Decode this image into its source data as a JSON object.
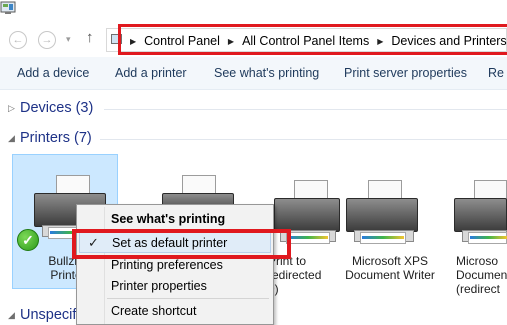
{
  "window": {
    "icon": "control-panel-icon"
  },
  "address": {
    "back_icon": "back-arrow-icon",
    "forward_icon": "forward-arrow-icon",
    "up_icon": "up-arrow-icon",
    "location_icon": "control-panel-icon",
    "back_glyph": "←",
    "forward_glyph": "→",
    "dropdown_glyph": "▾",
    "up_glyph": "↑",
    "separator_glyph": "▶",
    "breadcrumbs": [
      "Control Panel",
      "All Control Panel Items",
      "Devices and Printers"
    ]
  },
  "commandbar": {
    "items": [
      "Add a device",
      "Add a printer",
      "See what's printing",
      "Print server properties",
      "Re"
    ]
  },
  "groups": {
    "devices": {
      "label": "Devices (3)",
      "chevron": "▷"
    },
    "printers": {
      "label": "Printers (7)",
      "chevron": "◢"
    },
    "unspecified": {
      "label": "Unspecif",
      "chevron": "◢"
    }
  },
  "printers": [
    {
      "line1": "Bullzip",
      "line2": "Printe",
      "default": true
    },
    {
      "line1": "",
      "line2": ""
    },
    {
      "line1": "Print to",
      "line2": "redirected",
      "line3": "9)"
    },
    {
      "line1": "Microsoft XPS",
      "line2": "Document Writer"
    },
    {
      "line1": "Microso",
      "line2": "Documen",
      "line3": "(redirect"
    }
  ],
  "default_badge": "✓",
  "context_menu": {
    "check_glyph": "✓",
    "items": [
      {
        "label": "See what's printing",
        "bold": true
      },
      {
        "label": "Set as default printer",
        "checked": true,
        "highlighted": true
      },
      {
        "label": "Printing preferences"
      },
      {
        "label": "Printer properties"
      },
      {
        "label": "Create shortcut"
      }
    ]
  },
  "colors": {
    "annotation_red": "#e0191f",
    "selection_blue": "#cce8ff",
    "header_blue": "#1e3287",
    "command_text": "#1e395b"
  }
}
